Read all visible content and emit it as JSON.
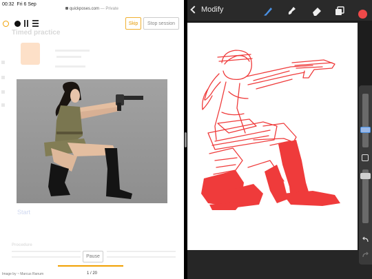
{
  "status": {
    "time": "00:32",
    "date": "Fri 6 Sep",
    "url": "quickposes.com",
    "private": "— Private"
  },
  "session": {
    "skip_label": "Skip",
    "stop_label": "Stop session",
    "faded_title": "Timed practice",
    "start_label": "Start",
    "section_heading": "Procedure",
    "pause_label": "Pause",
    "progress_fraction": 0.05,
    "credit": "Image by ~ Marcus Ranum",
    "page_count": "1 / 20"
  },
  "procreate": {
    "back_label": "Modify",
    "tools": [
      "brush-icon",
      "smudge-icon",
      "eraser-icon",
      "layers-icon"
    ],
    "color": "#ef4949",
    "sidebar_controls": [
      "brush-size-slider",
      "modify-button",
      "opacity-slider",
      "undo-icon",
      "redo-icon"
    ]
  },
  "colors": {
    "accent_orange": "#f0a000",
    "sketch_red": "#ef3b3b"
  }
}
